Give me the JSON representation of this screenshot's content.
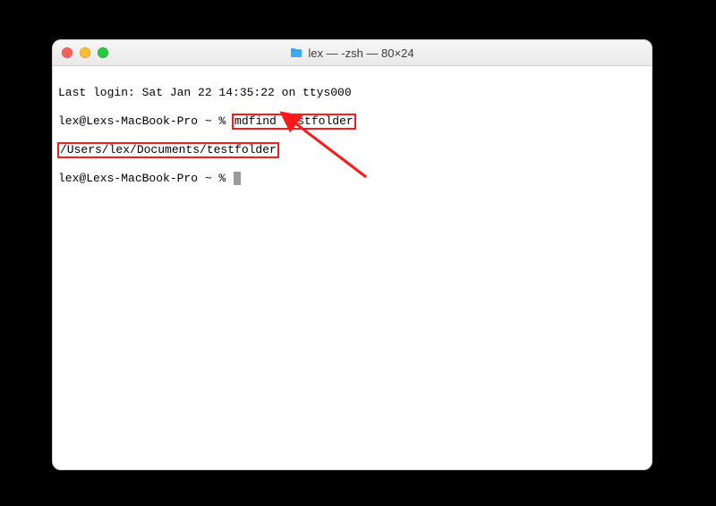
{
  "window": {
    "title": "lex — -zsh — 80×24"
  },
  "terminal": {
    "last_login": "Last login: Sat Jan 22 14:35:22 on ttys000",
    "prompt1_prefix": "lex@Lexs-MacBook-Pro ~ % ",
    "command": "mdfind testfolder",
    "output_path": "/Users/lex/Documents/testfolder",
    "prompt2_prefix": "lex@Lexs-MacBook-Pro ~ % "
  },
  "icons": {
    "folder": "folder-icon",
    "close": "close-icon",
    "minimize": "minimize-icon",
    "zoom": "zoom-icon"
  },
  "annotation": {
    "arrow_color": "#ff1a1a"
  }
}
